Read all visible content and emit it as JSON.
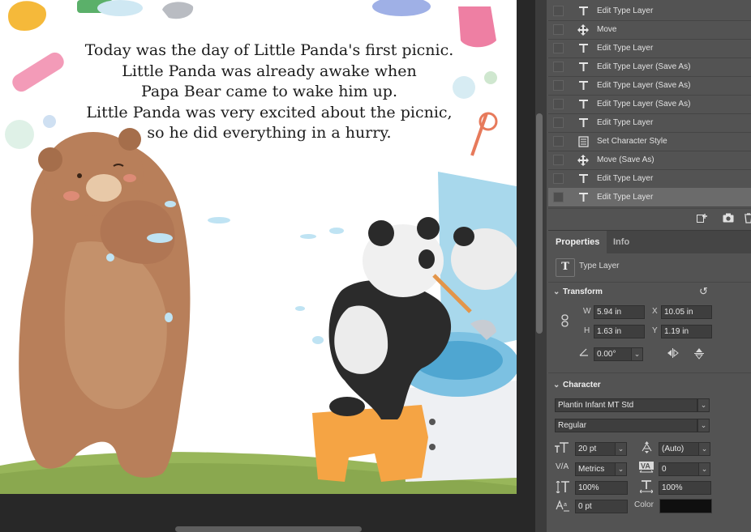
{
  "story": {
    "lines": [
      "Today was the day of Little Panda's first picnic.",
      "Little Panda was already awake when",
      "Papa Bear came to wake him up.",
      "Little Panda was very excited about the picnic,",
      "so he did everything in a hurry."
    ]
  },
  "history": {
    "items": [
      {
        "label": "Edit Type Layer",
        "icon": "type-icon"
      },
      {
        "label": "Move",
        "icon": "move-icon"
      },
      {
        "label": "Edit Type Layer",
        "icon": "type-icon"
      },
      {
        "label": "Edit Type Layer (Save As)",
        "icon": "type-icon"
      },
      {
        "label": "Edit Type Layer (Save As)",
        "icon": "type-icon"
      },
      {
        "label": "Edit Type Layer (Save As)",
        "icon": "type-icon"
      },
      {
        "label": "Edit Type Layer",
        "icon": "type-icon"
      },
      {
        "label": "Set Character Style",
        "icon": "style-icon"
      },
      {
        "label": "Move (Save As)",
        "icon": "move-icon"
      },
      {
        "label": "Edit Type Layer",
        "icon": "type-icon"
      },
      {
        "label": "Edit Type Layer",
        "icon": "type-icon"
      }
    ]
  },
  "properties": {
    "tabs": [
      "Properties",
      "Info"
    ],
    "layer_type": "Type Layer",
    "transform": {
      "title": "Transform",
      "w_label": "W",
      "w_value": "5.94 in",
      "h_label": "H",
      "h_value": "1.63 in",
      "x_label": "X",
      "x_value": "10.05 in",
      "y_label": "Y",
      "y_value": "1.19 in",
      "angle": "0.00°"
    },
    "character": {
      "title": "Character",
      "font_family": "Plantin Infant MT Std",
      "font_style": "Regular",
      "font_size": "20 pt",
      "leading": "(Auto)",
      "kerning": "Metrics",
      "tracking": "0",
      "vertical_scale": "100%",
      "horizontal_scale": "100%",
      "baseline_shift": "0 pt",
      "color_label": "Color",
      "color": "#0f0f0f"
    }
  },
  "colors": {
    "panel_bg": "#535353",
    "active_row": "#6b6b6b",
    "canvas_bg": "#282828"
  }
}
